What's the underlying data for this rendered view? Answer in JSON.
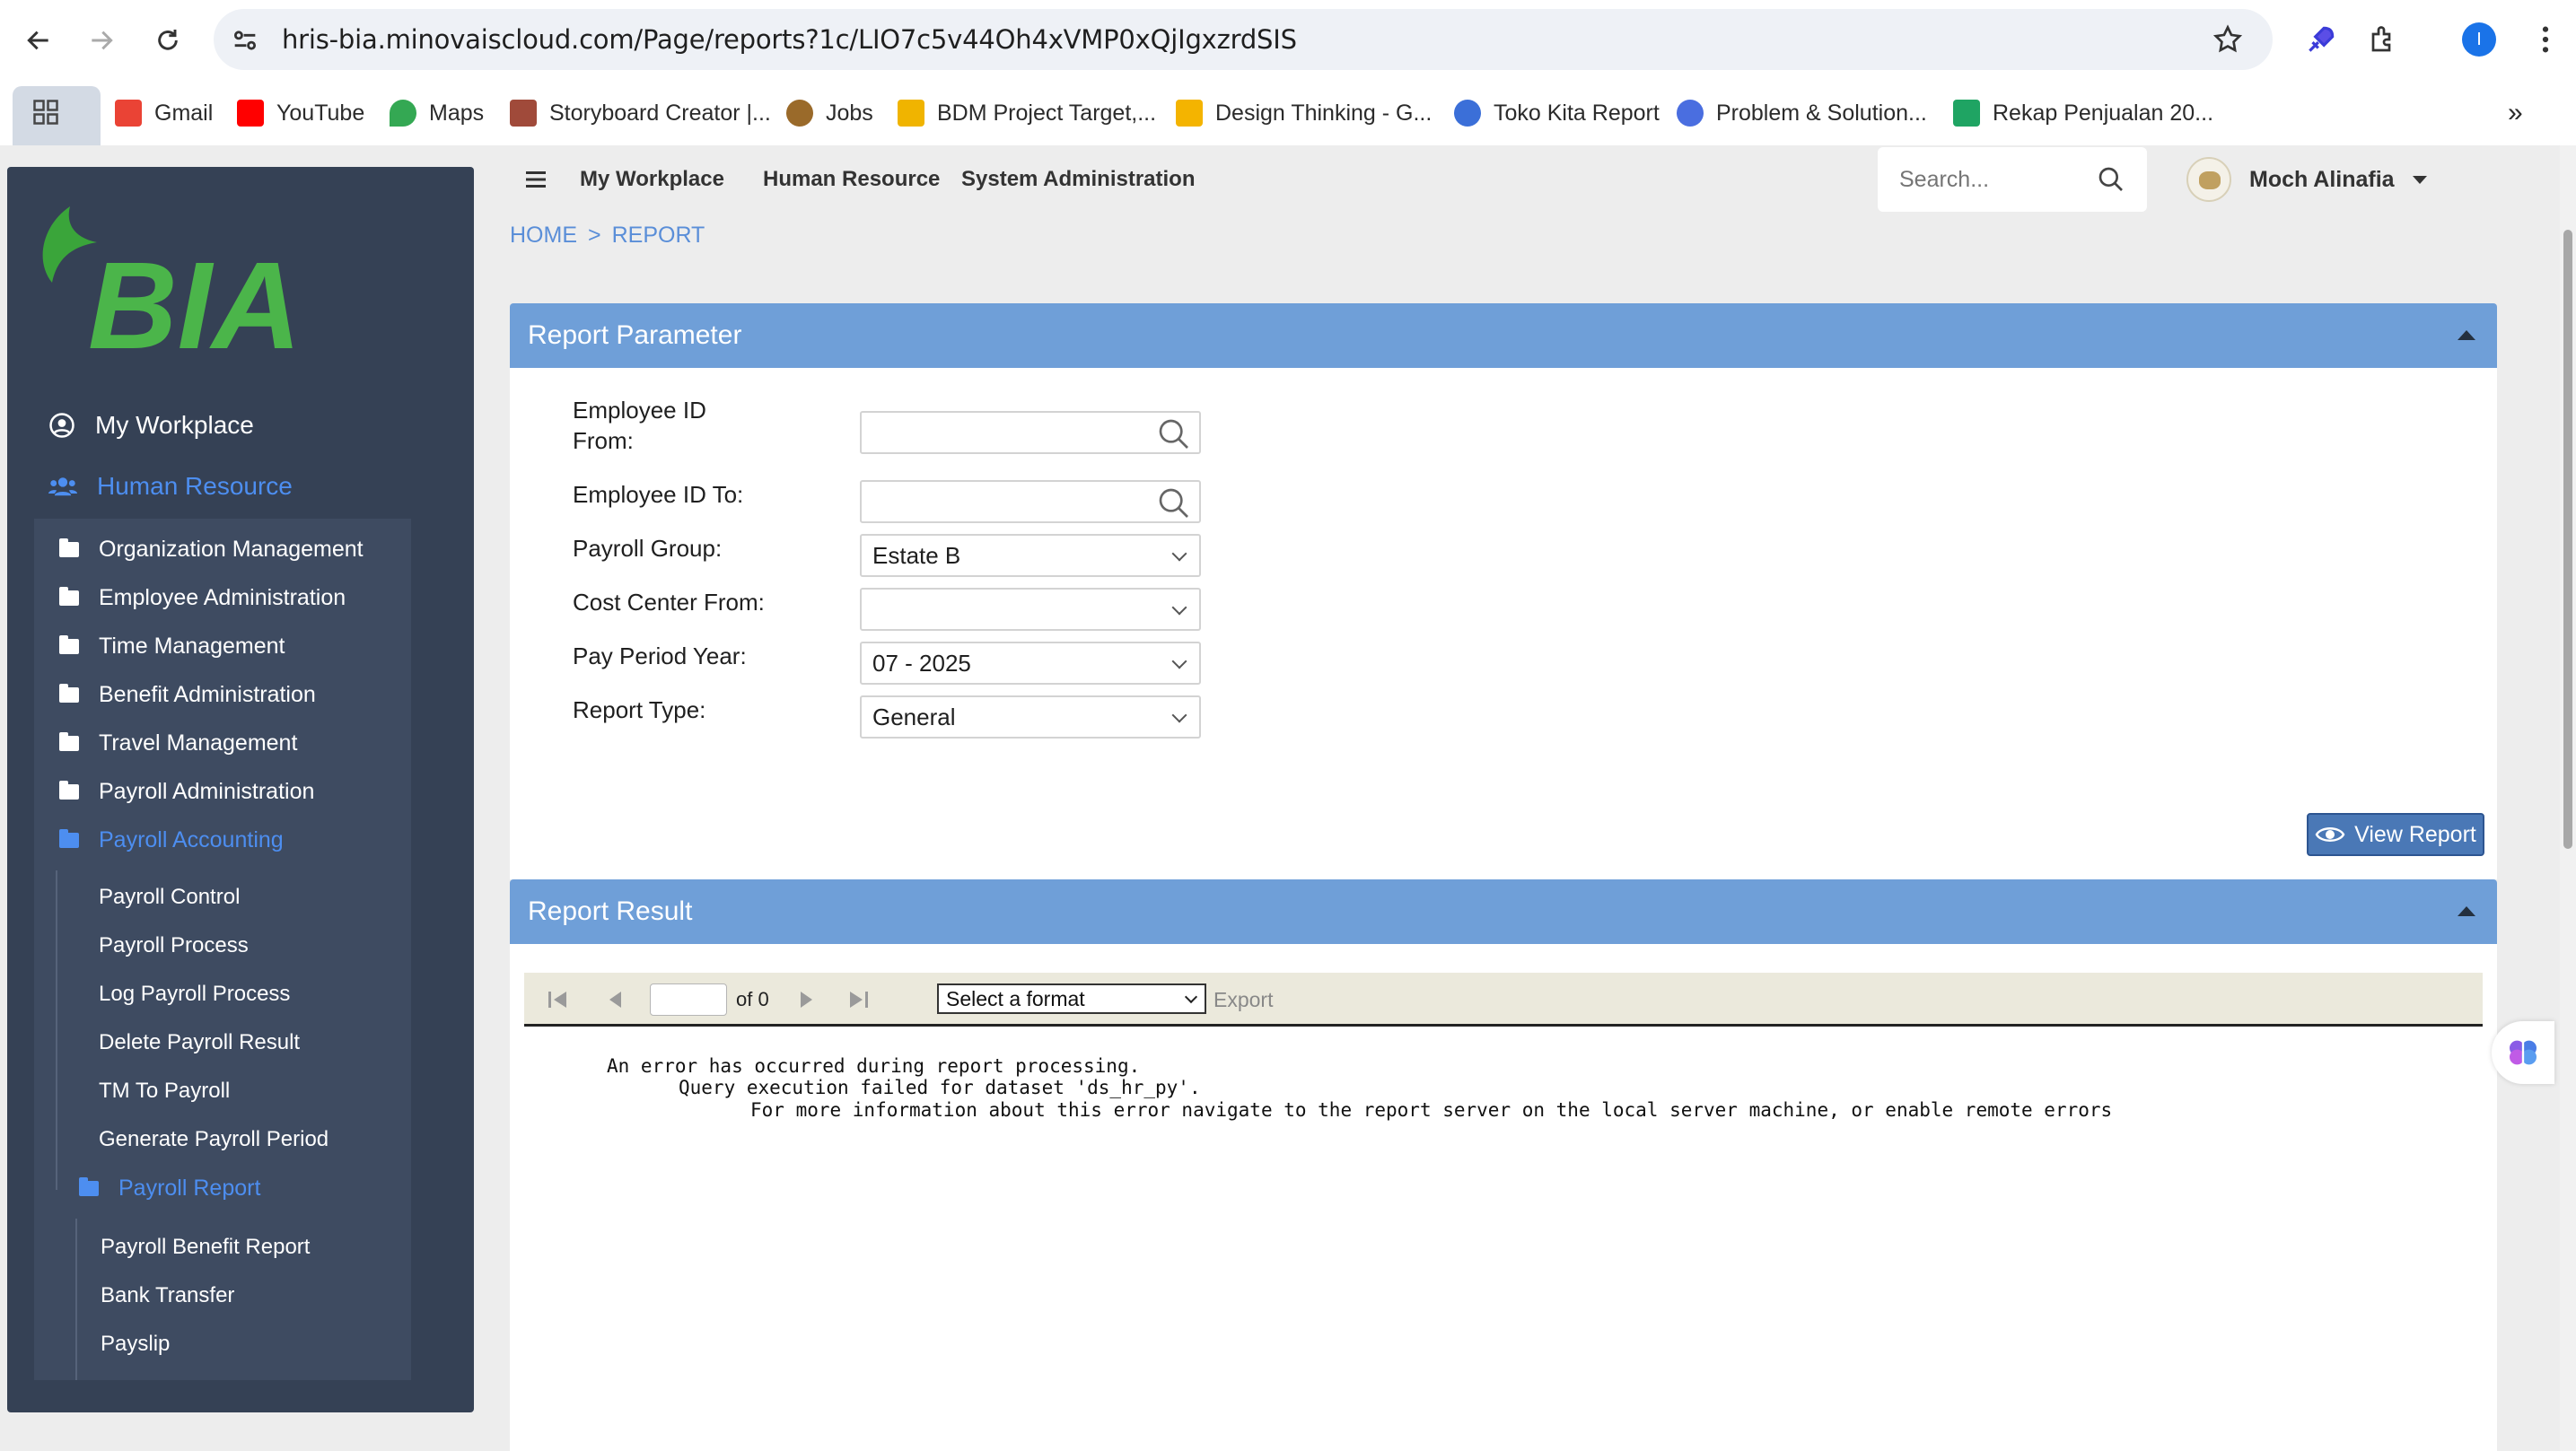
{
  "browser": {
    "url": "hris-bia.minovaiscloud.com/Page/reports?1c/LIO7c5v44Oh4xVMP0xQjIgxzrdSIS",
    "profile_initial": "I",
    "bookmarks": [
      {
        "label": "Gmail",
        "icon_color": "#ea4335"
      },
      {
        "label": "YouTube",
        "icon_color": "#ff0000"
      },
      {
        "label": "Maps",
        "icon_color": "#34a853"
      },
      {
        "label": "Storyboard Creator |...",
        "icon_color": "#a04a3a"
      },
      {
        "label": "Jobs",
        "icon_color": "#9a6a2a"
      },
      {
        "label": "BDM Project Target,...",
        "icon_color": "#f0b400"
      },
      {
        "label": "Design Thinking - G...",
        "icon_color": "#f4b400"
      },
      {
        "label": "Toko Kita Report",
        "icon_color": "#3b6fd8"
      },
      {
        "label": "Problem & Solution...",
        "icon_color": "#4a6ee0"
      },
      {
        "label": "Rekap Penjualan 20...",
        "icon_color": "#1fa463"
      }
    ]
  },
  "sidebar": {
    "logo_text": "BIA",
    "top_items": [
      {
        "label": "My Workplace",
        "icon": "user-circle-icon"
      },
      {
        "label": "Human Resource",
        "icon": "users-icon"
      }
    ],
    "groups": [
      "Organization Management",
      "Employee Administration",
      "Time Management",
      "Benefit Administration",
      "Travel Management",
      "Payroll Administration",
      "Payroll Accounting"
    ],
    "payroll_accounting_items": [
      "Payroll Control",
      "Payroll Process",
      "Log Payroll Process",
      "Delete Payroll Result",
      "TM To Payroll",
      "Generate Payroll Period",
      "Payroll Report"
    ],
    "payroll_report_items": [
      "Payroll Benefit Report",
      "Bank Transfer",
      "Payslip"
    ]
  },
  "topnav": {
    "links": [
      "My Workplace",
      "Human Resource",
      "System Administration"
    ],
    "search_placeholder": "Search...",
    "user_name": "Moch Alinafia"
  },
  "breadcrumb": {
    "home": "HOME",
    "separator": ">",
    "current": "REPORT"
  },
  "param_panel": {
    "title": "Report Parameter",
    "fields": {
      "emp_from_label_1": "Employee ID",
      "emp_from_label_2": "From:",
      "emp_to_label": "Employee ID To:",
      "payroll_group_label": "Payroll Group:",
      "payroll_group_value": "Estate B",
      "cost_center_label": "Cost Center From:",
      "cost_center_value": "",
      "period_label": "Pay Period Year:",
      "period_value": "07 - 2025",
      "report_type_label": "Report Type:",
      "report_type_value": "General"
    },
    "view_button": "View Report"
  },
  "result_panel": {
    "title": "Report Result",
    "page_of": "of 0",
    "format_select": "Select a format",
    "export_label": "Export",
    "error_line_1": "An error has occurred during report processing.",
    "error_line_2": "Query execution failed for dataset 'ds_hr_py'.",
    "error_line_3": "For more information about this error navigate to the report server on the local server machine, or enable remote errors"
  }
}
